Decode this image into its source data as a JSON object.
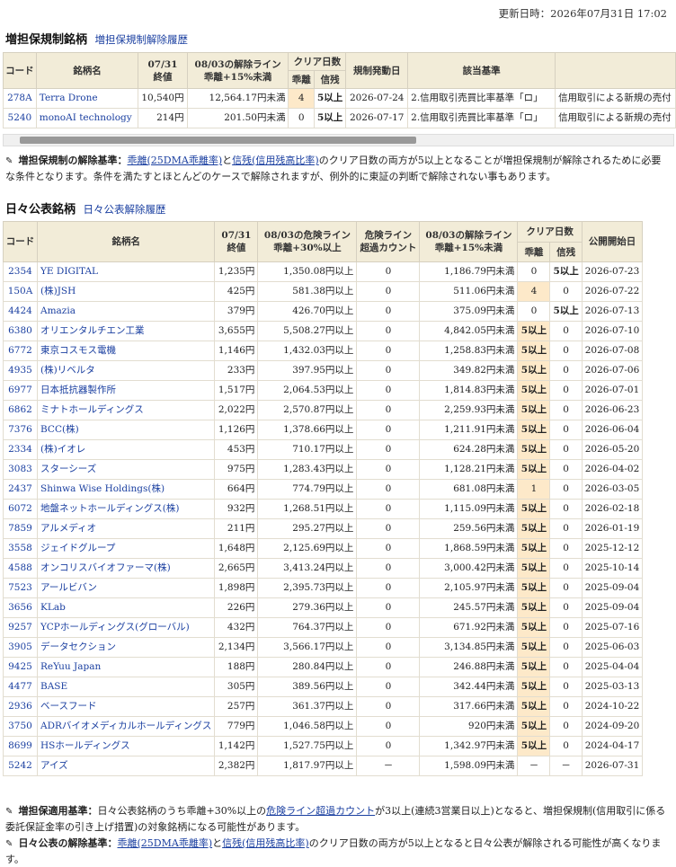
{
  "update_label": "更新日時：2026年07月31日 17:02",
  "margin": {
    "title": "増担保規制銘柄",
    "link": "増担保規制解除履歴",
    "headers": {
      "code": "コード",
      "name": "銘柄名",
      "close_a": "07/31",
      "close_b": "終値",
      "line_a": "08/03の解除ライン",
      "line_b": "乖離+15%未満",
      "clear": "クリア日数",
      "kairi": "乖離",
      "shinzan": "信残",
      "start": "規制発動日",
      "basis": "該当基準",
      "extra": ""
    },
    "rows": [
      {
        "code": "278A",
        "name": "Terra Drone",
        "close": "10,540円",
        "line": "12,564.17円未満",
        "kairi": "4",
        "shinzan": "5以上",
        "start": "2026-07-24",
        "basis": "2.信用取引売買比率基準「ロ」",
        "extra": "信用取引による新規の売付"
      },
      {
        "code": "5240",
        "name": "monoAI technology",
        "close": "214円",
        "line": "201.50円未満",
        "kairi": "0",
        "shinzan": "5以上",
        "start": "2026-07-17",
        "basis": "2.信用取引売買比率基準「ロ」",
        "extra": "信用取引による新規の売付"
      }
    ]
  },
  "note1": {
    "label": "増担保規制の解除基準：",
    "link1": "乖離(25DMA乖離率)",
    "mid": "と",
    "link2": "信残(信用残高比率)",
    "text": "のクリア日数の両方が5以上となることが増担保規制が解除されるために必要な条件となります。条件を満たすとほとんどのケースで解除されますが、例外的に東証の判断で解除されない事もあります。"
  },
  "daily": {
    "title": "日々公表銘柄",
    "link": "日々公表解除履歴",
    "headers": {
      "code": "コード",
      "name": "銘柄名",
      "close_a": "07/31",
      "close_b": "終値",
      "risk_a": "08/03の危険ライン",
      "risk_b": "乖離+30%以上",
      "over_a": "危険ライン",
      "over_b": "超過カウント",
      "line_a": "08/03の解除ライン",
      "line_b": "乖離+15%未満",
      "clear": "クリア日数",
      "kairi": "乖離",
      "shinzan": "信残",
      "start": "公開開始日"
    },
    "rows": [
      {
        "code": "2354",
        "name": "YE DIGITAL",
        "close": "1,235円",
        "risk": "1,350.08円以上",
        "over": "0",
        "line": "1,186.79円未満",
        "kairi": "0",
        "shinzan": "5以上",
        "start": "2026-07-23"
      },
      {
        "code": "150A",
        "name": "(株)JSH",
        "close": "425円",
        "risk": "581.38円以上",
        "over": "0",
        "line": "511.06円未満",
        "kairi": "4",
        "shinzan": "0",
        "start": "2026-07-22"
      },
      {
        "code": "4424",
        "name": "Amazia",
        "close": "379円",
        "risk": "426.70円以上",
        "over": "0",
        "line": "375.09円未満",
        "kairi": "0",
        "shinzan": "5以上",
        "start": "2026-07-13"
      },
      {
        "code": "6380",
        "name": "オリエンタルチエン工業",
        "close": "3,655円",
        "risk": "5,508.27円以上",
        "over": "0",
        "line": "4,842.05円未満",
        "kairi": "5以上",
        "shinzan": "0",
        "start": "2026-07-10"
      },
      {
        "code": "6772",
        "name": "東京コスモス電機",
        "close": "1,146円",
        "risk": "1,432.03円以上",
        "over": "0",
        "line": "1,258.83円未満",
        "kairi": "5以上",
        "shinzan": "0",
        "start": "2026-07-08"
      },
      {
        "code": "4935",
        "name": "(株)リベルタ",
        "close": "233円",
        "risk": "397.95円以上",
        "over": "0",
        "line": "349.82円未満",
        "kairi": "5以上",
        "shinzan": "0",
        "start": "2026-07-06"
      },
      {
        "code": "6977",
        "name": "日本抵抗器製作所",
        "close": "1,517円",
        "risk": "2,064.53円以上",
        "over": "0",
        "line": "1,814.83円未満",
        "kairi": "5以上",
        "shinzan": "0",
        "start": "2026-07-01"
      },
      {
        "code": "6862",
        "name": "ミナトホールディングス",
        "close": "2,022円",
        "risk": "2,570.87円以上",
        "over": "0",
        "line": "2,259.93円未満",
        "kairi": "5以上",
        "shinzan": "0",
        "start": "2026-06-23"
      },
      {
        "code": "7376",
        "name": "BCC(株)",
        "close": "1,126円",
        "risk": "1,378.66円以上",
        "over": "0",
        "line": "1,211.91円未満",
        "kairi": "5以上",
        "shinzan": "0",
        "start": "2026-06-04"
      },
      {
        "code": "2334",
        "name": "(株)イオレ",
        "close": "453円",
        "risk": "710.17円以上",
        "over": "0",
        "line": "624.28円未満",
        "kairi": "5以上",
        "shinzan": "0",
        "start": "2026-05-20"
      },
      {
        "code": "3083",
        "name": "スターシーズ",
        "close": "975円",
        "risk": "1,283.43円以上",
        "over": "0",
        "line": "1,128.21円未満",
        "kairi": "5以上",
        "shinzan": "0",
        "start": "2026-04-02"
      },
      {
        "code": "2437",
        "name": "Shinwa Wise Holdings(株)",
        "close": "664円",
        "risk": "774.79円以上",
        "over": "0",
        "line": "681.08円未満",
        "kairi": "1",
        "shinzan": "0",
        "start": "2026-03-05"
      },
      {
        "code": "6072",
        "name": "地盤ネットホールディングス(株)",
        "close": "932円",
        "risk": "1,268.51円以上",
        "over": "0",
        "line": "1,115.09円未満",
        "kairi": "5以上",
        "shinzan": "0",
        "start": "2026-02-18"
      },
      {
        "code": "7859",
        "name": "アルメディオ",
        "close": "211円",
        "risk": "295.27円以上",
        "over": "0",
        "line": "259.56円未満",
        "kairi": "5以上",
        "shinzan": "0",
        "start": "2026-01-19"
      },
      {
        "code": "3558",
        "name": "ジェイドグループ",
        "close": "1,648円",
        "risk": "2,125.69円以上",
        "over": "0",
        "line": "1,868.59円未満",
        "kairi": "5以上",
        "shinzan": "0",
        "start": "2025-12-12"
      },
      {
        "code": "4588",
        "name": "オンコリスバイオファーマ(株)",
        "close": "2,665円",
        "risk": "3,413.24円以上",
        "over": "0",
        "line": "3,000.42円未満",
        "kairi": "5以上",
        "shinzan": "0",
        "start": "2025-10-14"
      },
      {
        "code": "7523",
        "name": "アールビバン",
        "close": "1,898円",
        "risk": "2,395.73円以上",
        "over": "0",
        "line": "2,105.97円未満",
        "kairi": "5以上",
        "shinzan": "0",
        "start": "2025-09-04"
      },
      {
        "code": "3656",
        "name": "KLab",
        "close": "226円",
        "risk": "279.36円以上",
        "over": "0",
        "line": "245.57円未満",
        "kairi": "5以上",
        "shinzan": "0",
        "start": "2025-09-04"
      },
      {
        "code": "9257",
        "name": "YCPホールディングス(グローバル)",
        "close": "432円",
        "risk": "764.37円以上",
        "over": "0",
        "line": "671.92円未満",
        "kairi": "5以上",
        "shinzan": "0",
        "start": "2025-07-16"
      },
      {
        "code": "3905",
        "name": "データセクション",
        "close": "2,134円",
        "risk": "3,566.17円以上",
        "over": "0",
        "line": "3,134.85円未満",
        "kairi": "5以上",
        "shinzan": "0",
        "start": "2025-06-03"
      },
      {
        "code": "9425",
        "name": "ReYuu Japan",
        "close": "188円",
        "risk": "280.84円以上",
        "over": "0",
        "line": "246.88円未満",
        "kairi": "5以上",
        "shinzan": "0",
        "start": "2025-04-04"
      },
      {
        "code": "4477",
        "name": "BASE",
        "close": "305円",
        "risk": "389.56円以上",
        "over": "0",
        "line": "342.44円未満",
        "kairi": "5以上",
        "shinzan": "0",
        "start": "2025-03-13"
      },
      {
        "code": "2936",
        "name": "ベースフード",
        "close": "257円",
        "risk": "361.37円以上",
        "over": "0",
        "line": "317.66円未満",
        "kairi": "5以上",
        "shinzan": "0",
        "start": "2024-10-22"
      },
      {
        "code": "3750",
        "name": "ADRバイオメディカルホールディングス",
        "close": "779円",
        "risk": "1,046.58円以上",
        "over": "0",
        "line": "920円未満",
        "kairi": "5以上",
        "shinzan": "0",
        "start": "2024-09-20"
      },
      {
        "code": "8699",
        "name": "HSホールディングス",
        "close": "1,142円",
        "risk": "1,527.75円以上",
        "over": "0",
        "line": "1,342.97円未満",
        "kairi": "5以上",
        "shinzan": "0",
        "start": "2024-04-17"
      },
      {
        "code": "5242",
        "name": "アイズ",
        "close": "2,382円",
        "risk": "1,817.97円以上",
        "over": "－",
        "line": "1,598.09円未満",
        "kairi": "－",
        "shinzan": "－",
        "start": "2026-07-31"
      }
    ]
  },
  "note2": {
    "label": "増担保適用基準：",
    "text_a": "日々公表銘柄のうち乖離+30%以上の",
    "link": "危険ライン超過カウント",
    "text_b": "が3以上(連続3営業日以上)となると、増担保規制(信用取引に係る委託保証金率の引き上げ措置)の対象銘柄になる可能性があります。"
  },
  "note3": {
    "label": "日々公表の解除基準：",
    "link1": "乖離(25DMA乖離率)",
    "mid": "と",
    "link2": "信残(信用残高比率)",
    "text": "のクリア日数の両方が5以上となると日々公表が解除される可能性が高くなります。"
  }
}
